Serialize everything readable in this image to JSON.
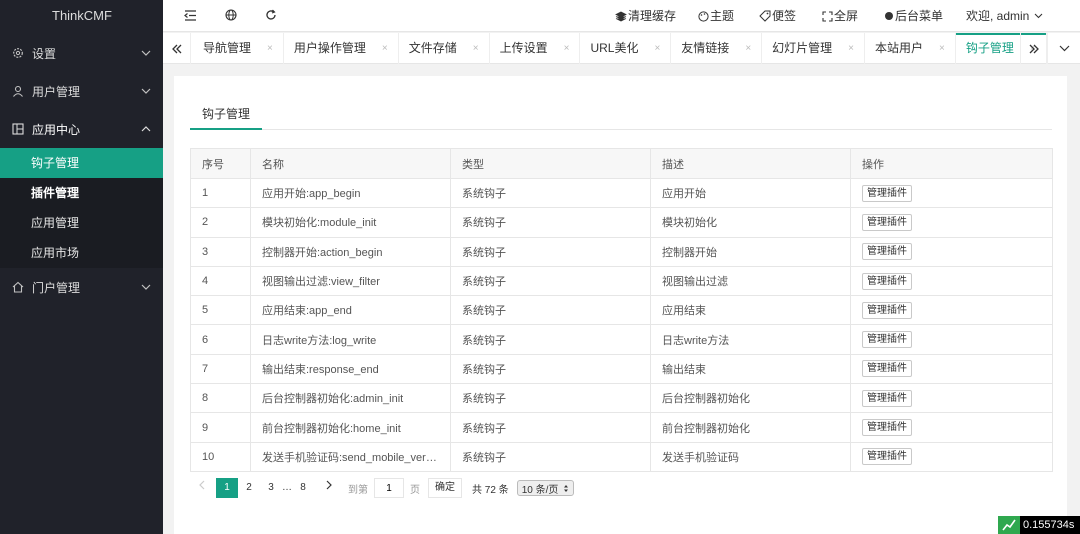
{
  "brand": "ThinkCMF",
  "sidebar": {
    "groups": [
      {
        "label": "设置"
      },
      {
        "label": "用户管理"
      },
      {
        "label": "应用中心"
      },
      {
        "label": "门户管理"
      }
    ],
    "sub": [
      {
        "label": "钩子管理"
      },
      {
        "label": "插件管理"
      },
      {
        "label": "应用管理"
      },
      {
        "label": "应用市场"
      }
    ]
  },
  "header": {
    "clear_cache": "清理缓存",
    "theme": "主题",
    "notes": "便签",
    "fullscreen": "全屏",
    "admin_menu": "后台菜单",
    "welcome": "欢迎, admin"
  },
  "tabs": [
    {
      "label": "导航管理"
    },
    {
      "label": "用户操作管理"
    },
    {
      "label": "文件存储"
    },
    {
      "label": "上传设置"
    },
    {
      "label": "URL美化"
    },
    {
      "label": "友情链接"
    },
    {
      "label": "幻灯片管理"
    },
    {
      "label": "本站用户"
    },
    {
      "label": "钩子管理"
    }
  ],
  "tab_close": "×",
  "inner_tab": "钩子管理",
  "table": {
    "headers": [
      "序号",
      "名称",
      "类型",
      "描述",
      "操作"
    ],
    "action_label": "管理插件",
    "rows": [
      {
        "id": "1",
        "name": "应用开始:app_begin",
        "type": "系统钩子",
        "desc": "应用开始"
      },
      {
        "id": "2",
        "name": "模块初始化:module_init",
        "type": "系统钩子",
        "desc": "模块初始化"
      },
      {
        "id": "3",
        "name": "控制器开始:action_begin",
        "type": "系统钩子",
        "desc": "控制器开始"
      },
      {
        "id": "4",
        "name": "视图输出过滤:view_filter",
        "type": "系统钩子",
        "desc": "视图输出过滤"
      },
      {
        "id": "5",
        "name": "应用结束:app_end",
        "type": "系统钩子",
        "desc": "应用结束"
      },
      {
        "id": "6",
        "name": "日志write方法:log_write",
        "type": "系统钩子",
        "desc": "日志write方法"
      },
      {
        "id": "7",
        "name": "输出结束:response_end",
        "type": "系统钩子",
        "desc": "输出结束"
      },
      {
        "id": "8",
        "name": "后台控制器初始化:admin_init",
        "type": "系统钩子",
        "desc": "后台控制器初始化"
      },
      {
        "id": "9",
        "name": "前台控制器初始化:home_init",
        "type": "系统钩子",
        "desc": "前台控制器初始化"
      },
      {
        "id": "10",
        "name": "发送手机验证码:send_mobile_verification_code",
        "type": "系统钩子",
        "desc": "发送手机验证码"
      }
    ]
  },
  "pager": {
    "pages": [
      "1",
      "2",
      "3"
    ],
    "ellipsis": "…",
    "last": "8",
    "goto": "到第",
    "goto_value": "1",
    "page_unit": "页",
    "confirm": "确定",
    "total": "共 72 条",
    "per_page": "10 条/页"
  },
  "timer": "0.155734s",
  "colors": {
    "accent": "#16a085",
    "sidebar": "#20222a"
  }
}
